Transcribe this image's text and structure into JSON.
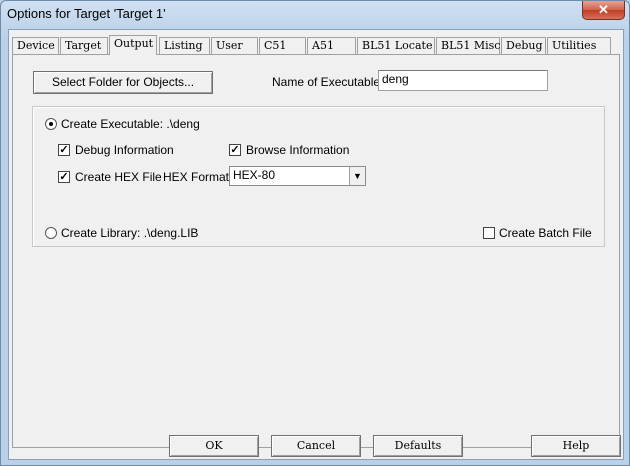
{
  "window": {
    "title": "Options for Target 'Target 1'",
    "close_glyph": "✕"
  },
  "tabs": [
    {
      "label": "Device"
    },
    {
      "label": "Target"
    },
    {
      "label": "Output"
    },
    {
      "label": "Listing"
    },
    {
      "label": "User"
    },
    {
      "label": "C51"
    },
    {
      "label": "A51"
    },
    {
      "label": "BL51 Locate"
    },
    {
      "label": "BL51 Misc"
    },
    {
      "label": "Debug"
    },
    {
      "label": "Utilities"
    }
  ],
  "active_tab": "Output",
  "output": {
    "select_folder_label": "Select Folder for Objects...",
    "name_label": "Name of Executable:",
    "name_value": "deng",
    "create_exe_label": "Create Executable:  .\\deng",
    "create_exe_selected": true,
    "debug_info_label": "Debug Information",
    "debug_info_checked": true,
    "browse_info_label": "Browse Information",
    "browse_info_checked": true,
    "create_hex_label": "Create HEX File",
    "create_hex_checked": true,
    "hex_format_label": "HEX Format:",
    "hex_format_value": "HEX-80",
    "create_lib_label": "Create Library:  .\\deng.LIB",
    "create_lib_selected": false,
    "batch_label": "Create Batch File",
    "batch_checked": false,
    "check_glyph": "✓",
    "dropdown_glyph": "▼"
  },
  "buttons": {
    "ok": "OK",
    "cancel": "Cancel",
    "defaults": "Defaults",
    "help": "Help"
  }
}
